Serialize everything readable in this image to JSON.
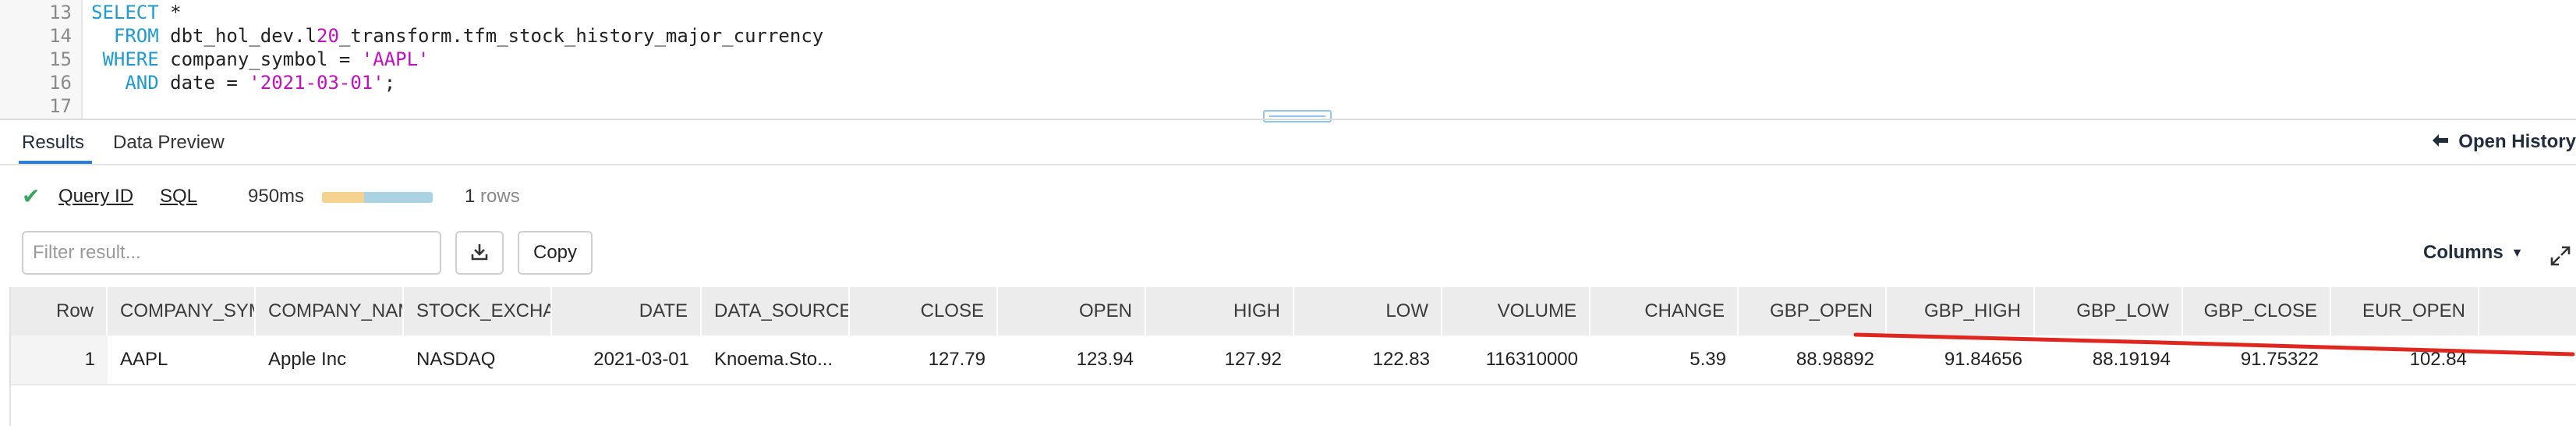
{
  "editor": {
    "lines": [
      {
        "num": "13",
        "parts": [
          {
            "t": "SELECT",
            "c": "kw"
          },
          {
            "t": " *",
            "c": ""
          }
        ]
      },
      {
        "num": "14",
        "parts": [
          {
            "t": "  FROM",
            "c": "kw"
          },
          {
            "t": " dbt_hol_dev.l",
            "c": ""
          },
          {
            "t": "20",
            "c": "num"
          },
          {
            "t": "_transform.tfm_stock_history_major_currency",
            "c": ""
          }
        ]
      },
      {
        "num": "15",
        "parts": [
          {
            "t": " WHERE",
            "c": "kw"
          },
          {
            "t": " company_symbol = ",
            "c": ""
          },
          {
            "t": "'AAPL'",
            "c": "str"
          }
        ]
      },
      {
        "num": "16",
        "parts": [
          {
            "t": "   AND",
            "c": "kw"
          },
          {
            "t": " date = ",
            "c": ""
          },
          {
            "t": "'2021-03-01'",
            "c": "str"
          },
          {
            "t": ";",
            "c": ""
          }
        ]
      },
      {
        "num": "17",
        "parts": []
      }
    ]
  },
  "tabs": {
    "results": "Results",
    "data_preview": "Data Preview",
    "open_history": "Open History"
  },
  "info": {
    "query_id": "Query ID",
    "sql": "SQL",
    "duration": "950ms",
    "duration_bar_fraction": 0.38,
    "rows_count": "1",
    "rows_label": "rows"
  },
  "filter": {
    "placeholder": "Filter result...",
    "value": ""
  },
  "toolbar": {
    "copy": "Copy",
    "columns": "Columns"
  },
  "table": {
    "columns": [
      "Row",
      "COMPANY_SYMBOL",
      "COMPANY_NAME",
      "STOCK_EXCHANGE",
      "DATE",
      "DATA_SOURCE_NAME",
      "CLOSE",
      "OPEN",
      "HIGH",
      "LOW",
      "VOLUME",
      "CHANGE",
      "GBP_OPEN",
      "GBP_HIGH",
      "GBP_LOW",
      "GBP_CLOSE",
      "EUR_OPEN"
    ],
    "rows": [
      [
        "1",
        "AAPL",
        "Apple Inc",
        "NASDAQ",
        "2021-03-01",
        "Knoema.Sto...",
        "127.79",
        "123.94",
        "127.92",
        "122.83",
        "116310000",
        "5.39",
        "88.98892",
        "91.84656",
        "88.19194",
        "91.75322",
        "102.84"
      ]
    ]
  },
  "colors": {
    "keyword": "#1d9bd1",
    "string": "#c10fc1",
    "success": "#3ba55d",
    "tab_active": "#2a7fd4",
    "annotation_red": "#e0271f",
    "header_bg": "#ececec"
  },
  "icons": [
    "check-icon",
    "download-icon",
    "arrow-left-icon",
    "caret-down-icon",
    "expand-icon"
  ]
}
